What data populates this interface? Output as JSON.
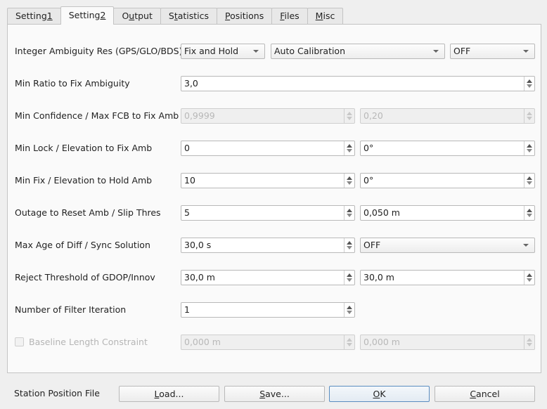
{
  "tabs": [
    {
      "pre": "Setting",
      "mn": "1",
      "post": "",
      "active": false
    },
    {
      "pre": "Setting",
      "mn": "2",
      "post": "",
      "active": true
    },
    {
      "pre": "O",
      "mn": "u",
      "post": "tput",
      "active": false
    },
    {
      "pre": "S",
      "mn": "t",
      "post": "atistics",
      "active": false
    },
    {
      "pre": "",
      "mn": "P",
      "post": "ositions",
      "active": false
    },
    {
      "pre": "",
      "mn": "F",
      "post": "iles",
      "active": false
    },
    {
      "pre": "",
      "mn": "M",
      "post": "isc",
      "active": false
    }
  ],
  "rows": {
    "ambiguity": {
      "label": "Integer Ambiguity Res (GPS/GLO/BDS)",
      "gps": "Fix and Hold",
      "glo": "Auto Calibration",
      "bds": "OFF"
    },
    "ratio": {
      "label": "Min Ratio to Fix Ambiguity",
      "value": "3,0"
    },
    "confidence": {
      "label": "Min Confidence / Max FCB to Fix Amb",
      "conf": "0,9999",
      "fcb": "0,20"
    },
    "lock": {
      "label": "Min Lock / Elevation to Fix Amb",
      "lock": "0",
      "elev": "0°"
    },
    "fix": {
      "label": "Min Fix / Elevation to Hold Amb",
      "fix": "10",
      "elev": "0°"
    },
    "outage": {
      "label": "Outage to Reset Amb / Slip Thres",
      "outage": "5",
      "slip": "0,050 m"
    },
    "maxage": {
      "label": "Max Age of Diff / Sync Solution",
      "age": "30,0 s",
      "sync": "OFF"
    },
    "reject": {
      "label": "Reject Threshold of GDOP/Innov",
      "gdop": "30,0 m",
      "innov": "30,0 m"
    },
    "iter": {
      "label": "Number of Filter Iteration",
      "value": "1"
    },
    "baseline": {
      "label": "Baseline Length Constraint",
      "checked": false,
      "len": "0,000 m",
      "sigma": "0,000 m"
    }
  },
  "footer": {
    "station_label": "Station Position File",
    "load": {
      "mn": "L",
      "post": "oad..."
    },
    "save": {
      "mn": "S",
      "post": "ave..."
    },
    "ok": {
      "mn": "O",
      "post": "K"
    },
    "cancel": {
      "mn": "C",
      "post": "ancel"
    }
  }
}
